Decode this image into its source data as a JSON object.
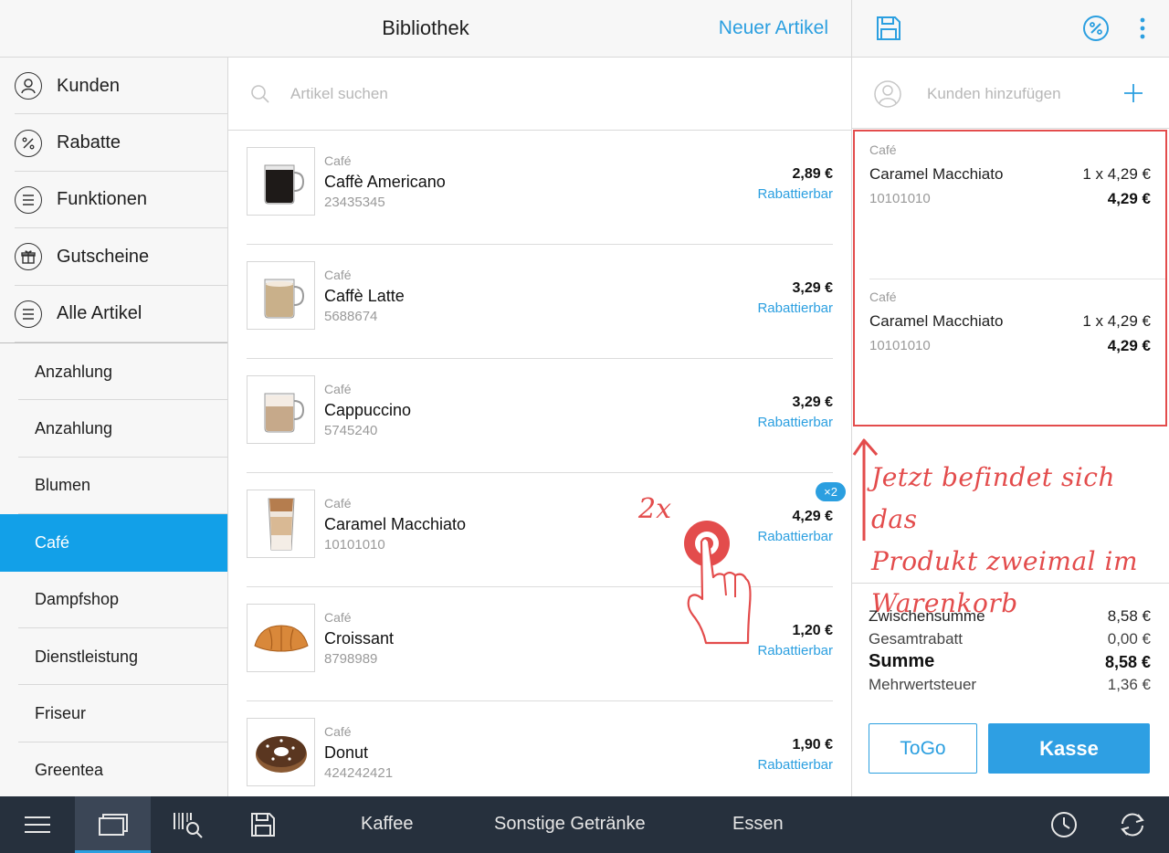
{
  "header": {
    "title": "Bibliothek",
    "new_item_label": "Neuer Artikel"
  },
  "cart_header": {
    "icons": [
      "save-icon",
      "discount-icon",
      "more-icon"
    ]
  },
  "sidebar": {
    "main": [
      {
        "label": "Kunden",
        "icon": "user-icon"
      },
      {
        "label": "Rabatte",
        "icon": "percent-icon"
      },
      {
        "label": "Funktionen",
        "icon": "list-icon"
      },
      {
        "label": "Gutscheine",
        "icon": "gift-icon"
      },
      {
        "label": "Alle Artikel",
        "icon": "list-icon"
      }
    ],
    "categories": [
      "Anzahlung",
      "Anzahlung",
      "Blumen",
      "Café",
      "Dampfshop",
      "Dienstleistung",
      "Friseur",
      "Greentea"
    ],
    "active_category": "Café"
  },
  "search": {
    "placeholder": "Artikel suchen"
  },
  "products": [
    {
      "category": "Café",
      "name": "Caffè Americano",
      "sku": "23435345",
      "price": "2,89 €",
      "discount": "Rabattierbar"
    },
    {
      "category": "Café",
      "name": "Caffè Latte",
      "sku": "5688674",
      "price": "3,29 €",
      "discount": "Rabattierbar"
    },
    {
      "category": "Café",
      "name": "Cappuccino",
      "sku": "5745240",
      "price": "3,29 €",
      "discount": "Rabattierbar"
    },
    {
      "category": "Café",
      "name": "Caramel Macchiato",
      "sku": "10101010",
      "price": "4,29 €",
      "discount": "Rabattierbar",
      "badge": "×2"
    },
    {
      "category": "Café",
      "name": "Croissant",
      "sku": "8798989",
      "price": "1,20 €",
      "discount": "Rabattierbar"
    },
    {
      "category": "Café",
      "name": "Donut",
      "sku": "424242421",
      "price": "1,90 €",
      "discount": "Rabattierbar"
    }
  ],
  "cart": {
    "add_customer_label": "Kunden hinzufügen",
    "lines": [
      {
        "category": "Café",
        "name": "Caramel Macchiato",
        "qty": "1 x 4,29 €",
        "sku": "10101010",
        "total": "4,29 €"
      },
      {
        "category": "Café",
        "name": "Caramel Macchiato",
        "qty": "1 x 4,29 €",
        "sku": "10101010",
        "total": "4,29 €"
      }
    ],
    "totals": {
      "subtotal_label": "Zwischensumme",
      "subtotal": "8,58 €",
      "discount_label": "Gesamtrabatt",
      "discount": "0,00 €",
      "sum_label": "Summe",
      "sum": "8,58 €",
      "tax_label": "Mehrwertsteuer",
      "tax": "1,36 €"
    },
    "togo_label": "ToGo",
    "checkout_label": "Kasse"
  },
  "annotation": {
    "tap_count": "2x",
    "lines": [
      "Jetzt befindet sich das",
      "Produkt zweimal im",
      "Warenkorb"
    ],
    "color": "#e34c4c"
  },
  "bottom_bar": {
    "tabs": [
      "Kaffee",
      "Sonstige Getränke",
      "Essen"
    ],
    "icons": [
      "menu-icon",
      "library-icon",
      "barcode-search-icon",
      "save-icon",
      "clock-icon",
      "sync-icon"
    ]
  },
  "colors": {
    "accent": "#2b9fe0",
    "active_category": "#12a0e8",
    "bottom_bar": "#26303d",
    "annotation": "#e34c4c"
  }
}
